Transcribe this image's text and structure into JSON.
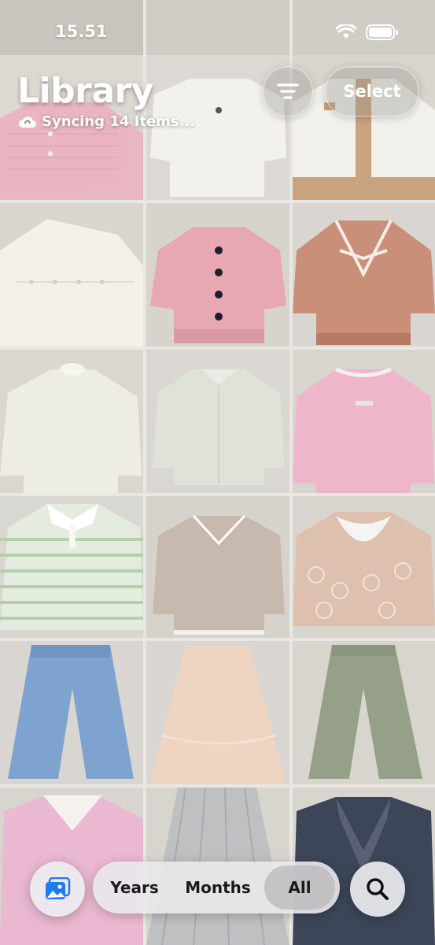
{
  "status_bar": {
    "time": "15.51"
  },
  "header": {
    "title": "Library",
    "sync_text": "Syncing 14 Items...",
    "select_label": "Select"
  },
  "bottom_bar": {
    "years_label": "Years",
    "months_label": "Months",
    "all_label": "All",
    "selected": "All"
  },
  "photos": [
    {
      "name": "pink knit cardigan"
    },
    {
      "name": "white long-sleeve shirt"
    },
    {
      "name": "white and tan cardigan"
    },
    {
      "name": "white button shirt"
    },
    {
      "name": "pink cable-knit cardigan"
    },
    {
      "name": "brown cardigan with bow"
    },
    {
      "name": "cream frill-neck blouse"
    },
    {
      "name": "pale green shirt"
    },
    {
      "name": "pink sweatshirt"
    },
    {
      "name": "green striped polo"
    },
    {
      "name": "beige collared knit top"
    },
    {
      "name": "lace-collar print blouse"
    },
    {
      "name": "blue denim jeans"
    },
    {
      "name": "peach tiered skirt"
    },
    {
      "name": "olive green trousers"
    },
    {
      "name": "pink lace-neck blouse"
    },
    {
      "name": "grey pleated skirt"
    },
    {
      "name": "navy lace jacket"
    }
  ]
}
